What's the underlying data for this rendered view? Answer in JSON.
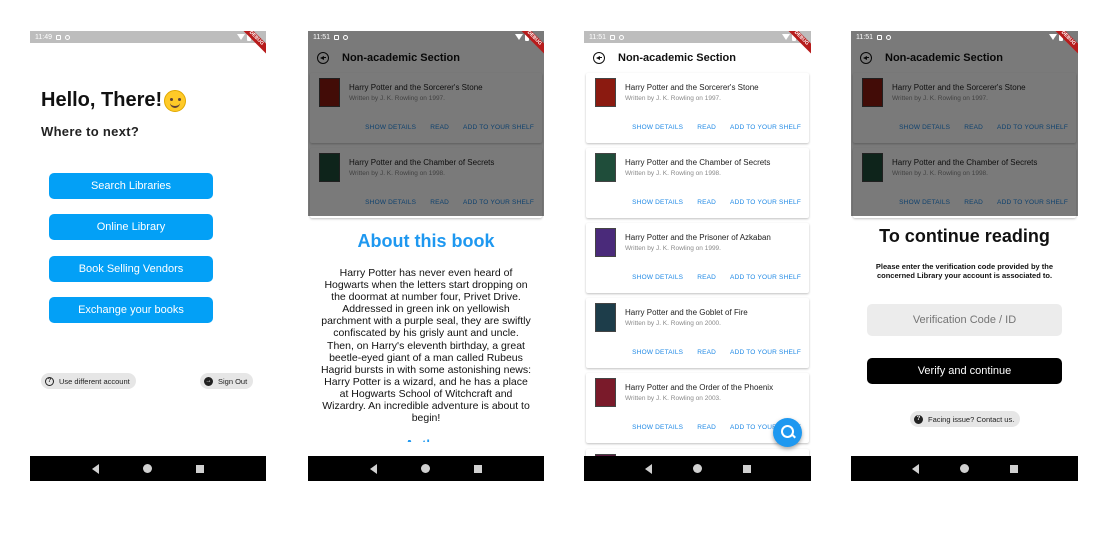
{
  "screens": {
    "home": {
      "status_time": "11:49",
      "greeting": "Hello, There!",
      "subtitle": "Where to next?",
      "buttons": [
        "Search Libraries",
        "Online Library",
        "Book Selling Vendors",
        "Exchange your books"
      ],
      "chip_left": "Use different account",
      "chip_right": "Sign Out"
    },
    "about": {
      "status_time": "11:51",
      "title": "About this book",
      "body": "Harry Potter has never even heard of Hogwarts when the letters start dropping on the doormat at number four, Privet Drive. Addressed in green ink on yellowish parchment with a purple seal, they are swiftly confiscated by his grisly aunt and uncle. Then, on Harry's eleventh birthday, a great beetle-eyed giant of a man called Rubeus Hagrid bursts in with some astonishing news: Harry Potter is a wizard, and he has a place at Hogwarts School of Witchcraft and Wizardry. An incredible adventure is about to begin!",
      "next_heading": "Author"
    },
    "list": {
      "status_time": "11:51"
    },
    "verify": {
      "status_time": "11:51",
      "title": "To continue reading",
      "body": "Please enter the verification code provided by the concerned Library your account is associated to.",
      "placeholder": "Verification Code / ID",
      "button": "Verify and continue",
      "help_chip": "Facing issue? Contact us."
    }
  },
  "appbar_title": "Non-academic Section",
  "debug_label": "DEBUG",
  "actions": {
    "details": "SHOW DETAILS",
    "read": "READ",
    "shelf": "ADD TO YOUR SHELF"
  },
  "books": [
    {
      "title": "Harry Potter and the Sorcerer's Stone",
      "sub": "Written by J. K. Rowling on 1997.",
      "color": "#8b1a10"
    },
    {
      "title": "Harry Potter and the Chamber of Secrets",
      "sub": "Written by J. K. Rowling on 1998.",
      "color": "#1f4d3a"
    },
    {
      "title": "Harry Potter and the Prisoner of Azkaban",
      "sub": "Written by J. K. Rowling on 1999.",
      "color": "#4a2a7a"
    },
    {
      "title": "Harry Potter and the Goblet of Fire",
      "sub": "Written by J. K. Rowling on 2000.",
      "color": "#1d3d4a"
    },
    {
      "title": "Harry Potter and the Order of the Phoenix",
      "sub": "Written by J. K. Rowling on 2003.",
      "color": "#7a1a2a"
    }
  ],
  "colors": {
    "primary_blue": "#03a0f6",
    "link_blue": "#1e88e5",
    "dark_button": "#000000",
    "navbar": "#000000"
  },
  "icons": [
    "back-icon",
    "search-icon",
    "help-icon",
    "sign-out-icon",
    "nav-back-icon",
    "nav-home-icon",
    "nav-recent-icon",
    "wifi-icon",
    "battery-icon"
  ]
}
